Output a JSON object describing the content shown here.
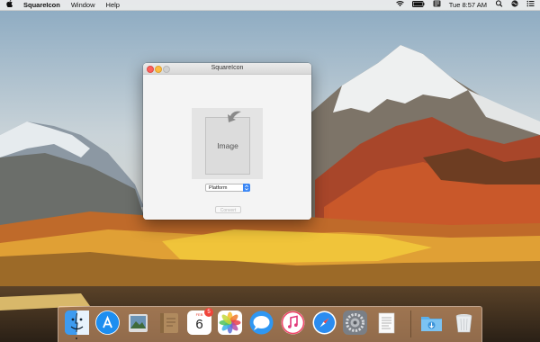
{
  "menubar": {
    "app_name": "SquareIcon",
    "menus": [
      "Window",
      "Help"
    ],
    "clock": "Tue 8:57 AM"
  },
  "window": {
    "title": "SquareIcon",
    "image_placeholder": "Image",
    "platform_select": "Platform",
    "convert_label": "Convert"
  },
  "dock": {
    "calendar_month": "FEB",
    "calendar_day": "6",
    "calendar_badge": "5",
    "items": [
      "Finder",
      "App Store",
      "Preview",
      "Notes Book",
      "Calendar",
      "Photos",
      "Messages",
      "iTunes",
      "Safari",
      "System Preferences",
      "TextEdit",
      "Downloads",
      "Trash"
    ]
  },
  "colors": {
    "accent": "#3b87f5",
    "close": "#fc605c",
    "minimize": "#fdbc40",
    "badge": "#f0443a"
  }
}
